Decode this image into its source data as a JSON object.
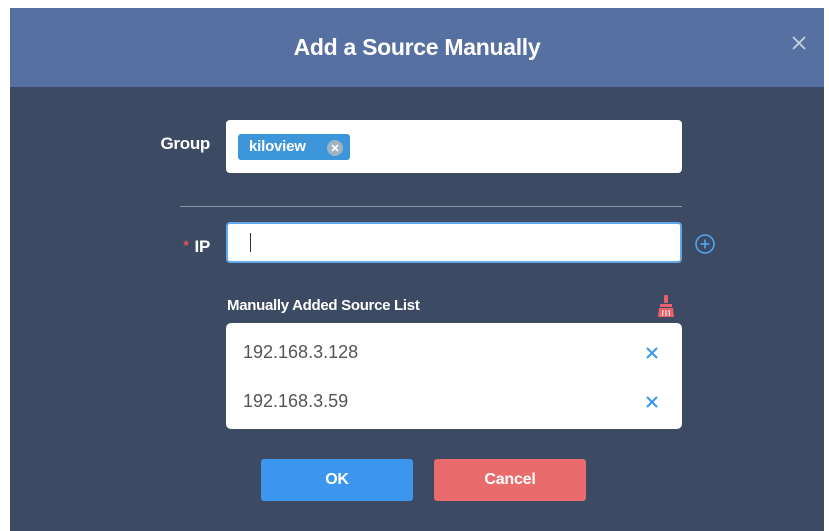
{
  "dialog": {
    "title": "Add a Source Manually",
    "close_icon": "close-icon"
  },
  "group": {
    "label": "Group",
    "tags": [
      {
        "label": "kiloview",
        "remove_icon": "tag-remove-icon"
      }
    ]
  },
  "ip": {
    "required_marker": "*",
    "label": "IP",
    "value": "",
    "add_icon": "plus-circle-icon"
  },
  "source_list": {
    "title": "Manually Added Source List",
    "clear_icon": "broom-icon",
    "items": [
      {
        "ip": "192.168.3.128",
        "remove_icon": "remove-x-icon"
      },
      {
        "ip": "192.168.3.59",
        "remove_icon": "remove-x-icon"
      }
    ]
  },
  "actions": {
    "ok_label": "OK",
    "cancel_label": "Cancel"
  },
  "colors": {
    "header_bg": "#5670a1",
    "body_bg": "#3d4a63",
    "tag_bg": "#3d96da",
    "accent_blue": "#3d96ee",
    "cancel_red": "#ea6b6b",
    "required_red": "#e0555a",
    "clear_icon_red": "#e8616a"
  }
}
